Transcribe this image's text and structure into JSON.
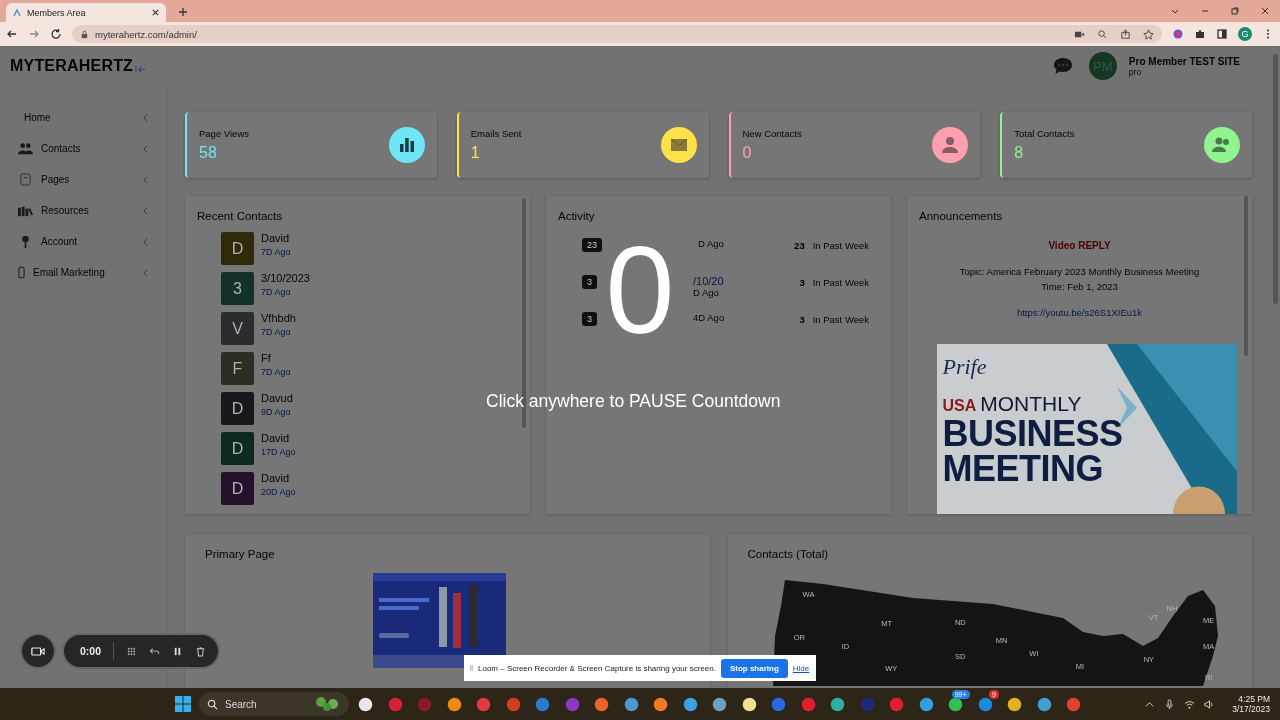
{
  "browser": {
    "tab_title": "Members Area",
    "url": "myterahertz.com/admin/",
    "profile": "G"
  },
  "header": {
    "logo": "MYTERAHERTZ",
    "avatar": "PM",
    "user_name": "Pro Member TEST SITE",
    "user_role": "pro"
  },
  "sidebar": {
    "items": [
      {
        "label": "Home",
        "kind": "plain"
      },
      {
        "label": "Contacts",
        "kind": "people"
      },
      {
        "label": "Pages",
        "kind": "page"
      },
      {
        "label": "Resources",
        "kind": "books"
      },
      {
        "label": "Account",
        "kind": "key"
      },
      {
        "label": "Email Marketing",
        "kind": "phone"
      }
    ]
  },
  "stats": [
    {
      "label": "Page Views",
      "value": "58",
      "color": "#6ee6f5",
      "kind": "chart"
    },
    {
      "label": "Emails Sent",
      "value": "1",
      "color": "#ffe24a",
      "kind": "mail"
    },
    {
      "label": "New Contacts",
      "value": "0",
      "color": "#ffa0ae",
      "kind": "person"
    },
    {
      "label": "Total Contacts",
      "value": "8",
      "color": "#90f590",
      "kind": "people"
    }
  ],
  "recent_contacts": {
    "title": "Recent Contacts",
    "items": [
      {
        "initial": "D",
        "name": "David",
        "ago": "7D Ago",
        "color": "#2e2a0a"
      },
      {
        "initial": "3",
        "name": "3/10/2023",
        "ago": "7D Ago",
        "color": "#12302c"
      },
      {
        "initial": "V",
        "name": "Vfhbdh",
        "ago": "7D Ago",
        "color": "#2a2c30"
      },
      {
        "initial": "F",
        "name": "Ff",
        "ago": "7D Ago",
        "color": "#2c2e24"
      },
      {
        "initial": "D",
        "name": "Davud",
        "ago": "9D Ago",
        "color": "#16181c"
      },
      {
        "initial": "D",
        "name": "David",
        "ago": "17D Ago",
        "color": "#0d2a20"
      },
      {
        "initial": "D",
        "name": "David",
        "ago": "20D Ago",
        "color": "#24102a"
      }
    ]
  },
  "activity": {
    "title": "Activity",
    "rows": [
      {
        "badge": "23",
        "ago": "D Ago",
        "count": "23",
        "period": "In Past Week"
      },
      {
        "badge": "3",
        "name": "/10/20",
        "ago": "D Ago",
        "count": "3",
        "period": "In Past Week"
      },
      {
        "badge": "3",
        "ago": "4D Ago",
        "count": "3",
        "period": "In Past Week"
      }
    ]
  },
  "announcements": {
    "title": "Announcements",
    "heading": "Video REPLY",
    "topic": "Topic: America February 2023 Monthly Business Meeting",
    "time": "Time: Feb 1, 2023",
    "link": "https://youtu.be/s26S1XIEu1k",
    "banner": {
      "brand": "Prife",
      "country": "USA",
      "line1": "MONTHLY",
      "line2": "BUSINESS",
      "line3": "MEETING"
    }
  },
  "primary_page": {
    "title": "Primary Page"
  },
  "contacts_map": {
    "title": "Contacts (Total)",
    "states": [
      "WA",
      "MT",
      "ND",
      "MN",
      "OR",
      "ID",
      "SD",
      "WY",
      "WI",
      "MI",
      "NY",
      "VT",
      "NH",
      "ME",
      "MA",
      "RI"
    ]
  },
  "countdown": {
    "number": "0",
    "hint": "Click anywhere to PAUSE Countdown"
  },
  "recorder": {
    "timer": "0:00"
  },
  "share_bar": {
    "message": "Loom – Screen Recorder & Screen Capture is sharing your screen.",
    "stop": "Stop sharing",
    "hide": "Hide"
  },
  "taskbar": {
    "search": "Search",
    "time": "4:25 PM",
    "date": "3/17/2023",
    "apps": [
      {
        "color": "#e8e8e8"
      },
      {
        "color": "#d8203a"
      },
      {
        "color": "#8a1a2a"
      },
      {
        "color": "#f08a10"
      },
      {
        "color": "#e03a3a"
      },
      {
        "color": "#d04020"
      },
      {
        "color": "#2a7ad0"
      },
      {
        "color": "#8a3ac0"
      },
      {
        "color": "#f0602a"
      },
      {
        "color": "#4a9ad0"
      },
      {
        "color": "#f07a20"
      },
      {
        "color": "#3aa0e0"
      },
      {
        "color": "#6aa0c0"
      },
      {
        "color": "#f0e090"
      },
      {
        "color": "#2a6ae0"
      },
      {
        "color": "#e02030"
      },
      {
        "color": "#2ab0a0"
      },
      {
        "color": "#1a2a80"
      },
      {
        "color": "#e02030"
      },
      {
        "color": "#30a0e0"
      },
      {
        "color": "#30c050",
        "badge": "99+"
      },
      {
        "color": "#1a8ae0",
        "badge": "9"
      },
      {
        "color": "#e0b020"
      },
      {
        "color": "#40a0d0"
      },
      {
        "color": "#e04030"
      }
    ]
  }
}
